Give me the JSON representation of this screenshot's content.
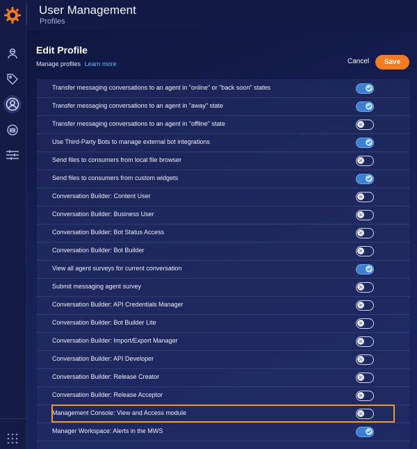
{
  "app": {
    "title": "User Management",
    "subtitle": "Profiles"
  },
  "page": {
    "title": "Edit Profile",
    "manage_text": "Manage profiles",
    "learn_more": "Learn more",
    "cancel_label": "Cancel",
    "save_label": "Save"
  },
  "colors": {
    "accent": "#f47b20",
    "toggle_on": "#3d7fd1",
    "highlight": "#f0962e",
    "background": "#0f1637"
  },
  "sidebar": {
    "icons": [
      "logo-icon",
      "agent-icon",
      "tag-icon",
      "user-circle-icon",
      "bot-icon",
      "sliders-icon",
      "apps-grid-icon"
    ]
  },
  "permissions": [
    {
      "label": "Transfer messaging conversations to an agent in \"online\" or \"back soon\" states",
      "enabled": true
    },
    {
      "label": "Transfer messaging conversations to an agent in \"away\" state",
      "enabled": true
    },
    {
      "label": "Transfer messaging conversations to an agent in \"offline\" state",
      "enabled": false
    },
    {
      "label": "Use Third-Party Bots to manage external bot integrations",
      "enabled": true
    },
    {
      "label": "Send files to consumers from local file browser",
      "enabled": false
    },
    {
      "label": "Send files to consumers from custom widgets",
      "enabled": true
    },
    {
      "label": "Conversation Builder: Content User",
      "enabled": false
    },
    {
      "label": "Conversation Builder: Business User",
      "enabled": false
    },
    {
      "label": "Conversation Builder: Bot Status Access",
      "enabled": false
    },
    {
      "label": "Conversation Builder: Bot Builder",
      "enabled": false
    },
    {
      "label": "View all agent surveys for current conversation",
      "enabled": true
    },
    {
      "label": "Submit messaging agent survey",
      "enabled": false
    },
    {
      "label": "Conversation Builder: API Credentials Manager",
      "enabled": false
    },
    {
      "label": "Conversation Builder: Bot Builder Lite",
      "enabled": false
    },
    {
      "label": "Conversation Builder: Import/Export Manager",
      "enabled": false
    },
    {
      "label": "Conversation Builder: API Developer",
      "enabled": false
    },
    {
      "label": "Conversation Builder: Release Creator",
      "enabled": false
    },
    {
      "label": "Conversation Builder: Release Acceptor",
      "enabled": false
    },
    {
      "label": "Management Console: View and Access module",
      "enabled": false,
      "highlighted": true
    },
    {
      "label": "Manager Workspace: Alerts in the MWS",
      "enabled": true
    }
  ]
}
